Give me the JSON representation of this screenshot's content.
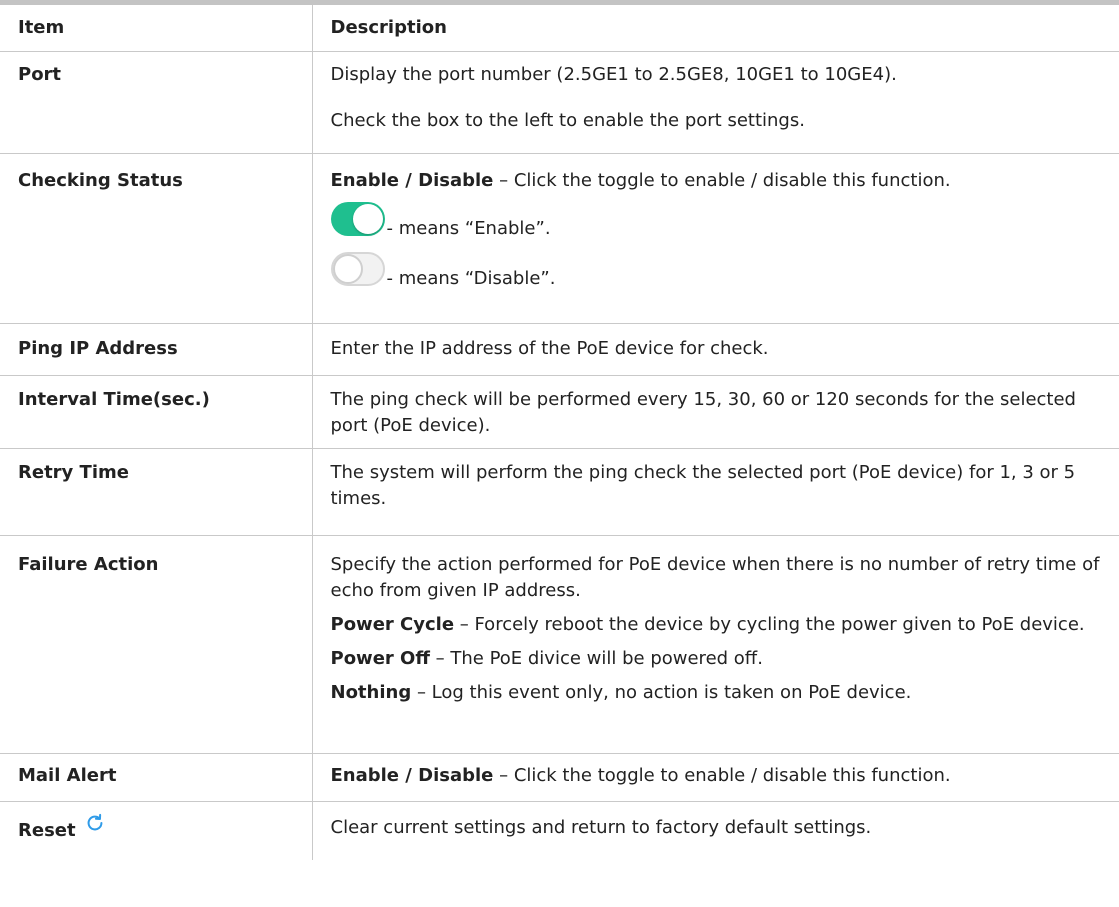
{
  "header": {
    "item": "Item",
    "description": "Description"
  },
  "rows": {
    "port": {
      "item": "Port",
      "desc1": "Display the port number (2.5GE1 to 2.5GE8, 10GE1 to 10GE4).",
      "desc2": "Check the box to the left to enable the port settings."
    },
    "checking_status": {
      "item": "Checking Status",
      "bold": "Enable / Disable",
      "text": " – Click the toggle to enable / disable this function.",
      "enable_label": "- means “Enable”.",
      "disable_label": "- means “Disable”.",
      "toggle_on_color": "#1fbf8f",
      "toggle_off_color": "#f2f2f2"
    },
    "ping_ip": {
      "item": "Ping IP Address",
      "desc": "Enter the IP address of the PoE device for check."
    },
    "interval_time": {
      "item": "Interval Time(sec.)",
      "desc": "The ping check will be performed every 15, 30, 60 or 120 seconds for the selected port (PoE device)."
    },
    "retry_time": {
      "item": "Retry Time",
      "desc": "The system will perform the ping check the selected port (PoE device) for 1, 3 or 5 times."
    },
    "failure_action": {
      "item": "Failure Action",
      "desc": "Specify the action performed for PoE device when there is no number of retry time of echo from given IP address.",
      "power_cycle_bold": "Power Cycle",
      "power_cycle_text": " – Forcely reboot the device by cycling the power given to PoE device.",
      "power_off_bold": "Power Off",
      "power_off_text": " – The PoE divice will be powered off.",
      "nothing_bold": "Nothing",
      "nothing_text": " – Log this event only, no action is taken on PoE device."
    },
    "mail_alert": {
      "item": "Mail Alert",
      "bold": "Enable / Disable",
      "text": " – Click the toggle to enable / disable this function."
    },
    "reset": {
      "item": "Reset",
      "icon": "refresh-icon",
      "icon_color": "#2f9be8",
      "desc": "Clear current settings and return to factory default settings."
    }
  }
}
